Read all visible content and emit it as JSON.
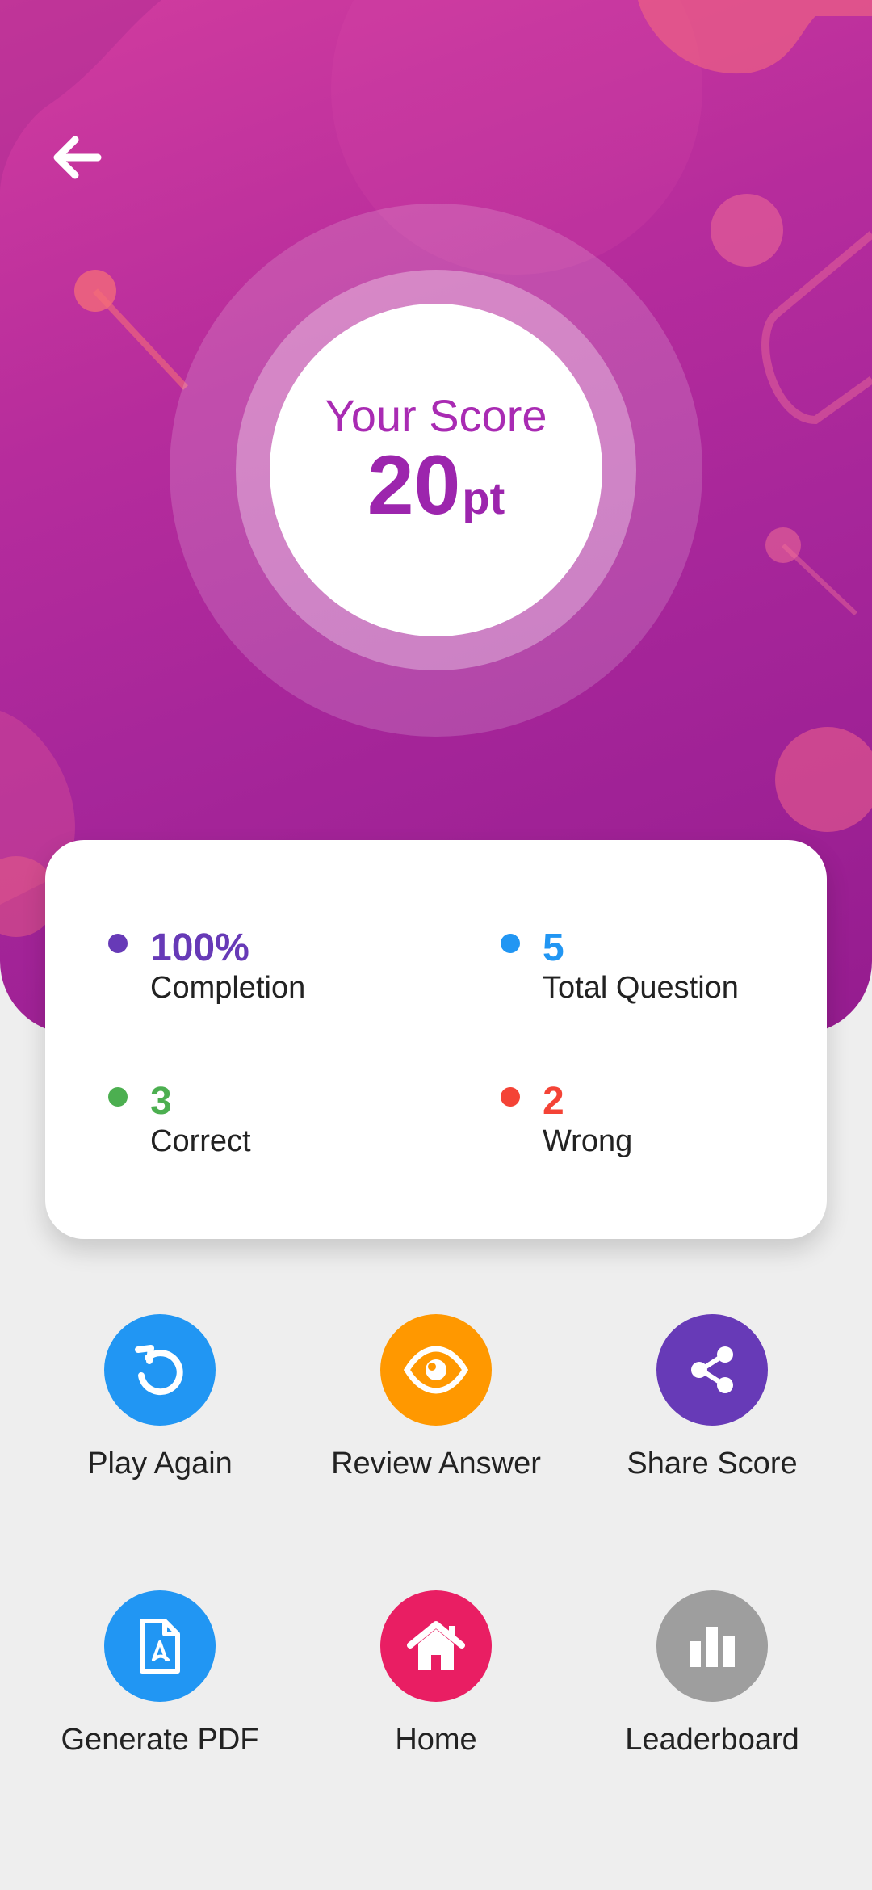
{
  "header": {
    "back_icon": "arrow-left-icon"
  },
  "score": {
    "title": "Your Score",
    "value": "20",
    "unit": "pt"
  },
  "stats": [
    {
      "value": "100%",
      "label": "Completion",
      "color": "#673ab7"
    },
    {
      "value": "5",
      "label": "Total Question",
      "color": "#2196f3"
    },
    {
      "value": "3",
      "label": "Correct",
      "color": "#4caf50"
    },
    {
      "value": "2",
      "label": "Wrong",
      "color": "#f44336"
    }
  ],
  "actions": [
    {
      "label": "Play Again",
      "icon": "replay-icon",
      "color": "#2196f3"
    },
    {
      "label": "Review Answer",
      "icon": "eye-icon",
      "color": "#ff9800"
    },
    {
      "label": "Share Score",
      "icon": "share-icon",
      "color": "#673ab7"
    },
    {
      "label": "Generate PDF",
      "icon": "pdf-icon",
      "color": "#2196f3"
    },
    {
      "label": "Home",
      "icon": "home-icon",
      "color": "#e91e63"
    },
    {
      "label": "Leaderboard",
      "icon": "leaderboard-icon",
      "color": "#9e9e9e"
    }
  ],
  "colors": {
    "hero_start": "#d13c9f",
    "hero_end": "#951c8f",
    "score_text": "#9c25ad",
    "background": "#eeeeee"
  }
}
